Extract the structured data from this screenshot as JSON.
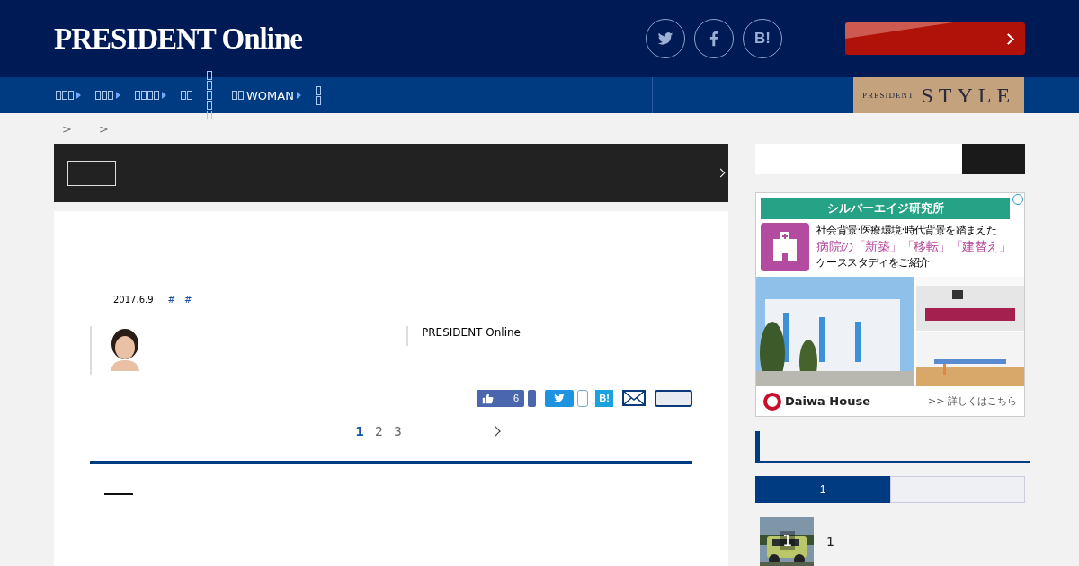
{
  "header": {
    "logo": "PRESIDENT Online",
    "social": [
      {
        "kind": "twitter"
      },
      {
        "kind": "facebook"
      },
      {
        "kind": "hatena",
        "label": "B!"
      }
    ]
  },
  "nav": {
    "items": [
      {
        "arrow": true
      },
      {
        "arrow": true
      },
      {
        "arrow": true
      },
      {
        "arrow": false
      },
      {
        "arrow": false
      },
      {
        "label": "WOMAN",
        "arrow": true
      },
      {
        "arrow": false
      }
    ],
    "style_logo": {
      "small": "PRESIDENT",
      "big": "STYLE"
    }
  },
  "breadcrumb": [
    ">",
    ">"
  ],
  "article": {
    "date": "2017.6.9",
    "tags": [
      "#",
      "#"
    ],
    "source": "PRESIDENT Online",
    "share": {
      "like_count": "6",
      "hatena": "B!"
    },
    "pages": [
      {
        "label": "1",
        "selected": true
      },
      {
        "label": "2",
        "selected": false
      },
      {
        "label": "3",
        "selected": false
      }
    ]
  },
  "ad": {
    "title": "シルバーエイジ研究所",
    "line1": "社会背景·医療環境·時代背景を踏まえた",
    "line2": "病院の「新築」「移転」「建替え」",
    "line3": "ケーススタディをご紹介",
    "brand": "Daiwa House",
    "more": ">> 詳しくはこちら"
  },
  "ranking": {
    "tabs": [
      {
        "label": "1",
        "selected": true
      },
      {
        "selected": false
      }
    ],
    "items": [
      {
        "rank": "1",
        "title": "1"
      }
    ]
  }
}
